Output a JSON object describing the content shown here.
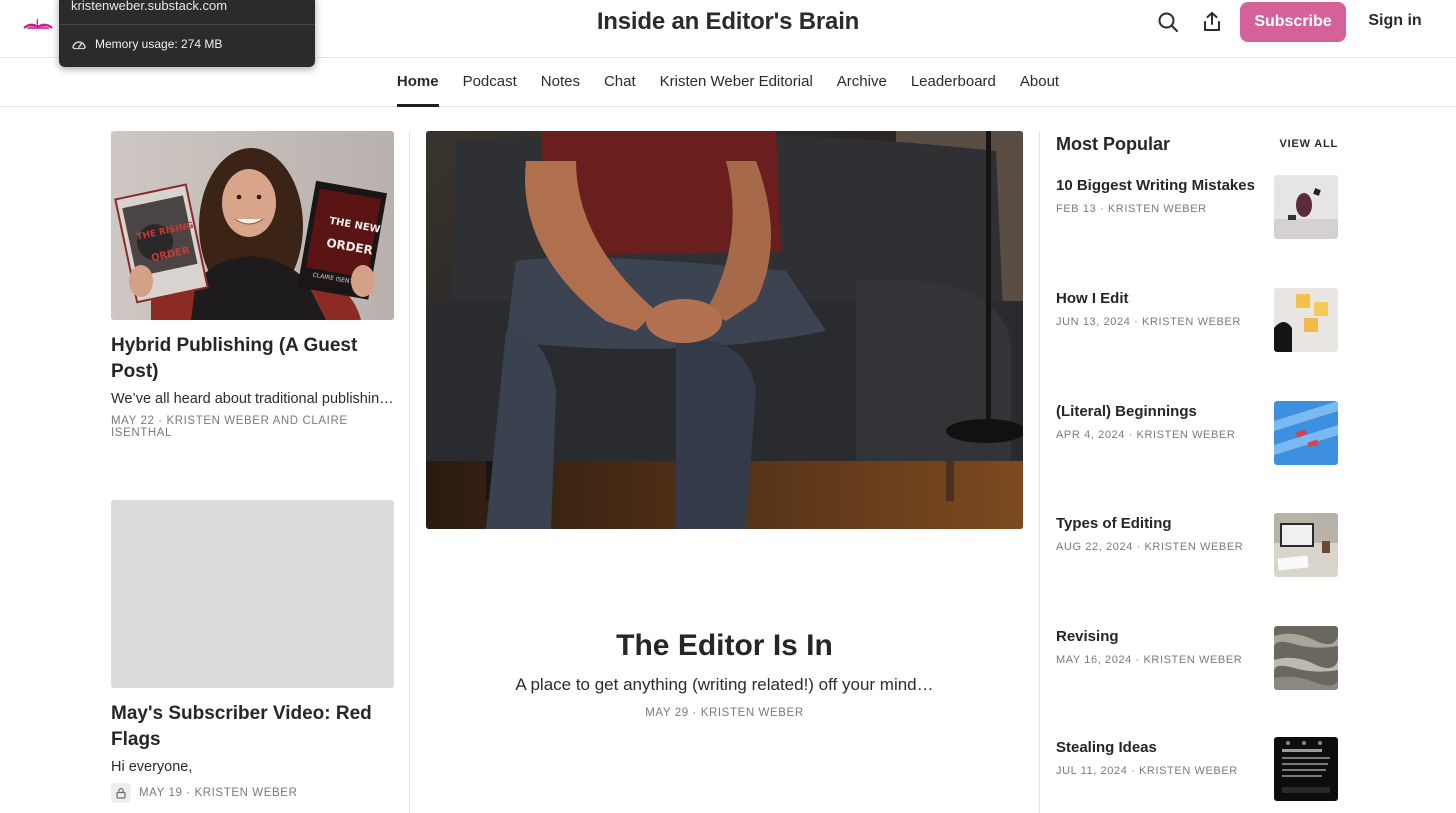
{
  "header": {
    "site_title": "Inside an Editor's Brain",
    "subscribe_label": "Subscribe",
    "signin_label": "Sign in",
    "accent_color": "#d6609a",
    "icons": [
      "search-icon",
      "share-icon"
    ]
  },
  "tooltip": {
    "url": "kristenweber.substack.com",
    "memory": "Memory usage: 274 MB"
  },
  "nav": {
    "items": [
      {
        "label": "Home",
        "active": true
      },
      {
        "label": "Podcast"
      },
      {
        "label": "Notes"
      },
      {
        "label": "Chat"
      },
      {
        "label": "Kristen Weber Editorial"
      },
      {
        "label": "Archive"
      },
      {
        "label": "Leaderboard"
      },
      {
        "label": "About"
      }
    ]
  },
  "left": {
    "posts": [
      {
        "title": "Hybrid Publishing (A Guest Post)",
        "subtitle": "We’ve all heard about traditional publishin…",
        "meta": "MAY 22 · KRISTEN WEBER AND CLAIRE ISENTHAL",
        "book_left": "THE RISING ORDER",
        "book_right": "THE NEW ORDER",
        "book_author": "CLAIRE ISENTHAL"
      },
      {
        "title": "May's Subscriber Video: Red Flags",
        "subtitle": "Hi everyone,",
        "meta": "MAY 19 · KRISTEN WEBER",
        "locked": true
      }
    ]
  },
  "center": {
    "title": "The Editor Is In",
    "subtitle": "A place to get anything (writing related!) off your mind…",
    "meta": "MAY 29 · KRISTEN WEBER"
  },
  "most_popular": {
    "title": "Most Popular",
    "view_all": "VIEW ALL",
    "items": [
      {
        "title": "10 Biggest Writing Mistakes",
        "meta": "FEB 13 · KRISTEN WEBER"
      },
      {
        "title": "How I Edit",
        "meta": "JUN 13, 2024 · KRISTEN WEBER"
      },
      {
        "title": "(Literal) Beginnings",
        "meta": "APR 4, 2024 · KRISTEN WEBER"
      },
      {
        "title": "Types of Editing",
        "meta": "AUG 22, 2024 · KRISTEN WEBER"
      },
      {
        "title": "Revising",
        "meta": "MAY 16, 2024 · KRISTEN WEBER"
      },
      {
        "title": "Stealing Ideas",
        "meta": "JUL 11, 2024 · KRISTEN WEBER"
      }
    ]
  }
}
